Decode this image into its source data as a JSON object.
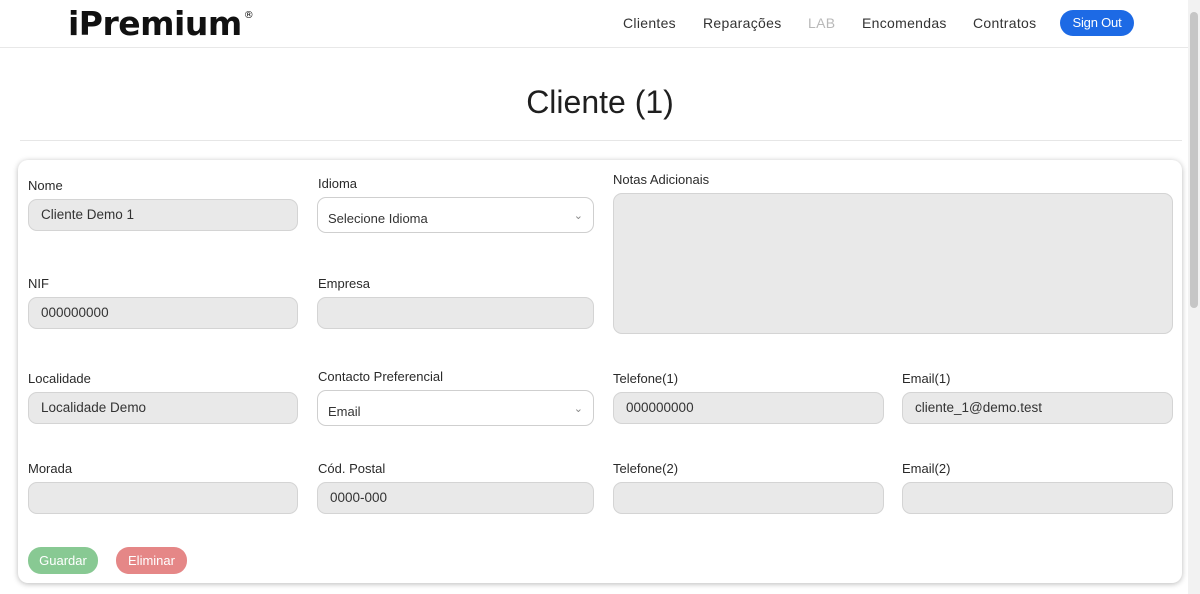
{
  "brand": {
    "name": "iPremium",
    "mark": "®"
  },
  "nav": {
    "items": [
      {
        "label": "Clientes"
      },
      {
        "label": "Reparações"
      },
      {
        "label": "LAB"
      },
      {
        "label": "Encomendas"
      },
      {
        "label": "Contratos"
      }
    ],
    "sign_out": "Sign Out"
  },
  "page": {
    "title": "Cliente (1)"
  },
  "form": {
    "nome": {
      "label": "Nome",
      "value": "Cliente Demo 1"
    },
    "idioma": {
      "label": "Idioma",
      "value": "Selecione Idioma"
    },
    "notas": {
      "label": "Notas Adicionais",
      "value": ""
    },
    "nif": {
      "label": "NIF",
      "value": "000000000"
    },
    "empresa": {
      "label": "Empresa",
      "value": ""
    },
    "localidade": {
      "label": "Localidade",
      "value": "Localidade Demo"
    },
    "contacto": {
      "label": "Contacto Preferencial",
      "value": "Email"
    },
    "telefone1": {
      "label": "Telefone(1)",
      "value": "000000000"
    },
    "email1": {
      "label": "Email(1)",
      "value": "cliente_1@demo.test"
    },
    "morada": {
      "label": "Morada",
      "value": ""
    },
    "postal": {
      "label": "Cód. Postal",
      "value": "0000-000"
    },
    "telefone2": {
      "label": "Telefone(2)",
      "value": ""
    },
    "email2": {
      "label": "Email(2)",
      "value": ""
    }
  },
  "actions": {
    "save": "Guardar",
    "delete": "Eliminar"
  },
  "icons": {
    "select_caret": "chevron-down-icon"
  },
  "colors": {
    "primary": "#1d6ae5",
    "save": "#88c993",
    "delete": "#e58787"
  }
}
